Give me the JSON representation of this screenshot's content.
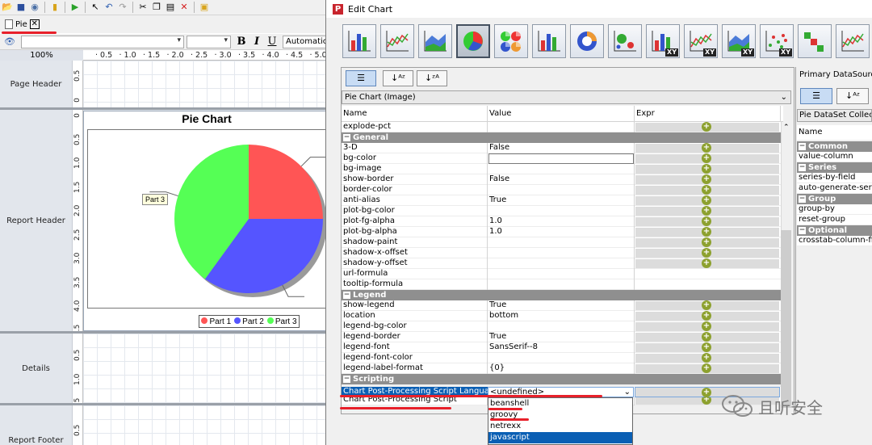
{
  "designer": {
    "doc_tab": "Pie",
    "zoom": "100%",
    "format_bar": {
      "bold": "B",
      "italic": "I",
      "underline": "U",
      "auto_label": "Automatic"
    },
    "ruler_h": [
      "0.5",
      "1.0",
      "1.5",
      "2.0",
      "2.5",
      "3.0",
      "3.5",
      "4.0",
      "4.5",
      "5.0"
    ],
    "bands": {
      "page_header": "Page Header",
      "report_header": "Report Header",
      "details": "Details",
      "report_footer": "Report Footer"
    },
    "vruler_page_header": [
      "0.5",
      "0"
    ],
    "vruler_report_header": [
      "0",
      "0.5",
      "1.0",
      "1.5",
      "2.0",
      "2.5",
      "3.0",
      "3.5",
      "4.0",
      "4.5"
    ],
    "vruler_details": [
      "0.5",
      "1.0",
      "1.5"
    ],
    "vruler_footer": [
      "0.5"
    ],
    "chart": {
      "title": "Pie Chart",
      "callout": "Part 3",
      "legend": [
        {
          "label": "Part 1",
          "color": "#ff5555"
        },
        {
          "label": "Part 2",
          "color": "#5555ff"
        },
        {
          "label": "Part 3",
          "color": "#55ff55"
        }
      ]
    }
  },
  "chart_data": {
    "type": "pie",
    "title": "Pie Chart",
    "categories": [
      "Part 1",
      "Part 2",
      "Part 3"
    ],
    "values": [
      25,
      35,
      40
    ],
    "colors": [
      "#ff5555",
      "#5555ff",
      "#55ff55"
    ],
    "legend_position": "bottom"
  },
  "dialog": {
    "title": "Edit Chart",
    "chart_types": [
      "bar-chart-icon",
      "line-chart-icon",
      "area-chart-icon",
      "pie-chart-icon",
      "multi-pie-chart-icon",
      "bar-line-chart-icon",
      "ring-chart-icon",
      "bubble-chart-icon",
      "xy-bar-chart-icon",
      "xy-line-chart-icon",
      "xy-area-chart-icon",
      "xy-scatter-chart-icon",
      "waterfall-chart-icon",
      "radar-chart-icon"
    ],
    "xy_badge": "XY",
    "selected_chart_type": 3,
    "combo": "Pie Chart (Image)",
    "headers": {
      "name": "Name",
      "value": "Value",
      "expr": "Expr"
    },
    "rows": [
      {
        "kind": "prop",
        "name": "explode-pct",
        "value": "",
        "expr": true
      },
      {
        "kind": "group",
        "name": "General"
      },
      {
        "kind": "prop",
        "name": "3-D",
        "value": "False",
        "expr": true
      },
      {
        "kind": "prop",
        "name": "bg-color",
        "value": "",
        "expr": true
      },
      {
        "kind": "prop",
        "name": "bg-image",
        "value": "",
        "expr": true
      },
      {
        "kind": "prop",
        "name": "show-border",
        "value": "False",
        "expr": true
      },
      {
        "kind": "prop",
        "name": "border-color",
        "value": "",
        "expr": true
      },
      {
        "kind": "prop",
        "name": "anti-alias",
        "value": "True",
        "expr": true
      },
      {
        "kind": "prop",
        "name": "plot-bg-color",
        "value": "",
        "expr": true
      },
      {
        "kind": "prop",
        "name": "plot-fg-alpha",
        "value": "1.0",
        "expr": true
      },
      {
        "kind": "prop",
        "name": "plot-bg-alpha",
        "value": "1.0",
        "expr": true
      },
      {
        "kind": "prop",
        "name": "shadow-paint",
        "value": "",
        "expr": true
      },
      {
        "kind": "prop",
        "name": "shadow-x-offset",
        "value": "",
        "expr": true
      },
      {
        "kind": "prop",
        "name": "shadow-y-offset",
        "value": "",
        "expr": true
      },
      {
        "kind": "prop",
        "name": "url-formula",
        "value": "",
        "expr": false
      },
      {
        "kind": "prop",
        "name": "tooltip-formula",
        "value": "",
        "expr": false
      },
      {
        "kind": "group",
        "name": "Legend"
      },
      {
        "kind": "prop",
        "name": "show-legend",
        "value": "True",
        "expr": true
      },
      {
        "kind": "prop",
        "name": "location",
        "value": "bottom",
        "expr": true
      },
      {
        "kind": "prop",
        "name": "legend-bg-color",
        "value": "",
        "expr": true
      },
      {
        "kind": "prop",
        "name": "legend-border",
        "value": "True",
        "expr": true
      },
      {
        "kind": "prop",
        "name": "legend-font",
        "value": "SansSerif--8",
        "expr": true
      },
      {
        "kind": "prop",
        "name": "legend-font-color",
        "value": "",
        "expr": true
      },
      {
        "kind": "prop",
        "name": "legend-label-format",
        "value": "{0}",
        "expr": true
      },
      {
        "kind": "group",
        "name": "Scripting"
      },
      {
        "kind": "prop",
        "name": "Chart Post-Processing Script Language",
        "value": "<undefined>",
        "expr": true
      },
      {
        "kind": "prop",
        "name": "Chart Post-Processing Script",
        "value": "",
        "expr": true
      }
    ],
    "selected_row": {
      "name": "Chart Post-Processing Script Language",
      "value": "<undefined>"
    },
    "dropdown_options": [
      "beanshell",
      "groovy",
      "netrexx",
      "javascript"
    ],
    "dropdown_selected": 3
  },
  "right_panel": {
    "label": "Primary DataSource",
    "combo": "Pie DataSet Collector",
    "header": "Name",
    "rows": [
      {
        "kind": "group",
        "name": "Common"
      },
      {
        "kind": "prop",
        "name": "value-column"
      },
      {
        "kind": "group",
        "name": "Series"
      },
      {
        "kind": "prop",
        "name": "series-by-field"
      },
      {
        "kind": "prop",
        "name": "auto-generate-series"
      },
      {
        "kind": "group",
        "name": "Group"
      },
      {
        "kind": "prop",
        "name": "group-by"
      },
      {
        "kind": "prop",
        "name": "reset-group"
      },
      {
        "kind": "group",
        "name": "Optional"
      },
      {
        "kind": "prop",
        "name": "crosstab-column-filter"
      }
    ]
  },
  "watermark": "且听安全",
  "accent": {
    "red_annotation": "#e8202a",
    "selection_blue": "#0a5fb4",
    "plus_green": "#8da12f"
  }
}
